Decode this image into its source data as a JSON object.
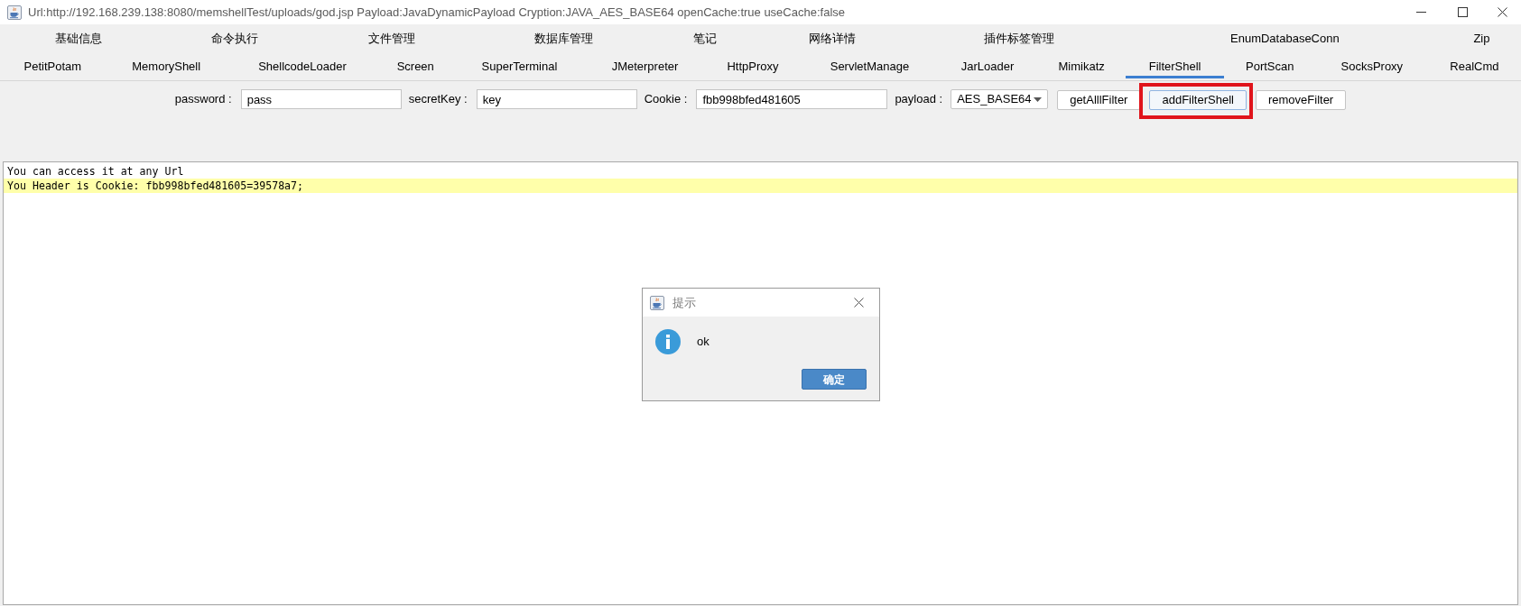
{
  "window": {
    "title": "Url:http://192.168.239.138:8080/memshellTest/uploads/god.jsp Payload:JavaDynamicPayload Cryption:JAVA_AES_BASE64 openCache:true useCache:false"
  },
  "tab_rows": [
    {
      "tabs": [
        {
          "label": "基础信息",
          "selected": false
        },
        {
          "label": "命令执行",
          "selected": false
        },
        {
          "label": "文件管理",
          "selected": false
        },
        {
          "label": "数据库管理",
          "selected": false
        },
        {
          "label": "笔记",
          "selected": false
        },
        {
          "label": "网络详情",
          "selected": false
        },
        {
          "label": "插件标签管理",
          "selected": false
        },
        {
          "label": "EnumDatabaseConn",
          "selected": false
        },
        {
          "label": "Zip",
          "selected": false
        }
      ]
    },
    {
      "tabs": [
        {
          "label": "PetitPotam",
          "selected": false
        },
        {
          "label": "MemoryShell",
          "selected": false
        },
        {
          "label": "ShellcodeLoader",
          "selected": false
        },
        {
          "label": "Screen",
          "selected": false
        },
        {
          "label": "SuperTerminal",
          "selected": false
        },
        {
          "label": "JMeterpreter",
          "selected": false
        },
        {
          "label": "HttpProxy",
          "selected": false
        },
        {
          "label": "ServletManage",
          "selected": false
        },
        {
          "label": "JarLoader",
          "selected": false
        },
        {
          "label": "Mimikatz",
          "selected": false
        },
        {
          "label": "FilterShell",
          "selected": true
        },
        {
          "label": "PortScan",
          "selected": false
        },
        {
          "label": "SocksProxy",
          "selected": false
        },
        {
          "label": "RealCmd",
          "selected": false
        }
      ]
    }
  ],
  "form": {
    "fields": [
      {
        "label": "password :",
        "value": "pass"
      },
      {
        "label": "secretKey :",
        "value": "key"
      },
      {
        "label": "Cookie :",
        "value": "fbb998bfed481605"
      }
    ],
    "payload": {
      "label": "payload :",
      "value": "AES_BASE64"
    },
    "buttons": [
      {
        "label": "getAlllFilter",
        "focused": false,
        "marked": false
      },
      {
        "label": "addFilterShell",
        "focused": true,
        "marked": true
      },
      {
        "label": "removeFilter",
        "focused": false,
        "marked": false
      }
    ]
  },
  "output": {
    "lines": [
      {
        "text": "You can access it at any Url",
        "highlighted": false
      },
      {
        "text": "You Header is Cookie: fbb998bfed481605=39578a7;",
        "highlighted": true
      }
    ]
  },
  "dialog": {
    "title": "提示",
    "message": "ok",
    "button": "确定"
  }
}
